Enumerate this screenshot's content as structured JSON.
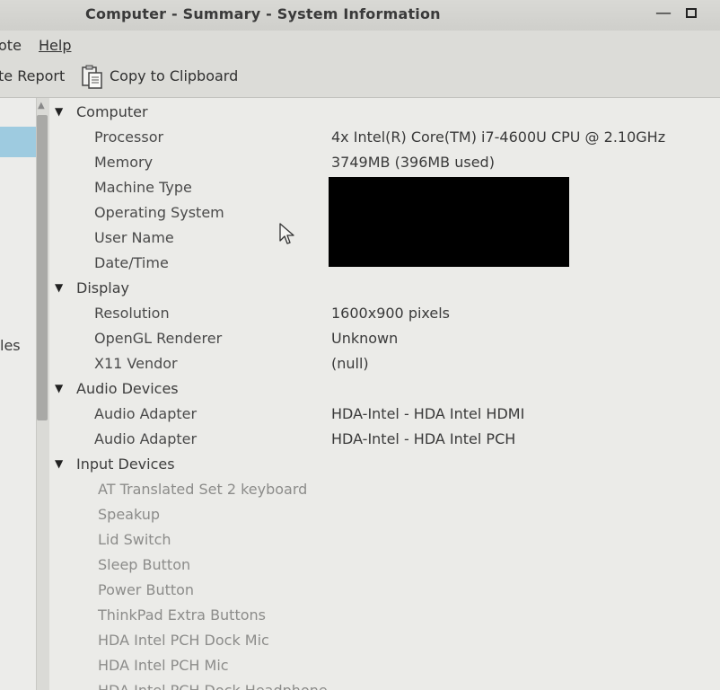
{
  "window": {
    "title": "Computer - Summary - System Information"
  },
  "menubar": {
    "items": [
      {
        "label": "ote"
      },
      {
        "label": "Help"
      }
    ]
  },
  "toolbar": {
    "generate_label": "te Report",
    "copy_label": "Copy to Clipboard",
    "copy_icon": "clipboard-icon"
  },
  "sidebar": {
    "partial_label": "les"
  },
  "tree": {
    "computer": {
      "label": "Computer",
      "rows": [
        {
          "key": "Processor",
          "value": "4x Intel(R) Core(TM) i7-4600U CPU @ 2.10GHz"
        },
        {
          "key": "Memory",
          "value": "3749MB (396MB used)"
        },
        {
          "key": "Machine Type",
          "value": ""
        },
        {
          "key": "Operating System",
          "value": ""
        },
        {
          "key": "User Name",
          "value": ""
        },
        {
          "key": "Date/Time",
          "value": ""
        }
      ]
    },
    "display": {
      "label": "Display",
      "rows": [
        {
          "key": "Resolution",
          "value": "1600x900 pixels"
        },
        {
          "key": "OpenGL Renderer",
          "value": "Unknown"
        },
        {
          "key": "X11 Vendor",
          "value": "(null)"
        }
      ]
    },
    "audio": {
      "label": "Audio Devices",
      "rows": [
        {
          "key": "Audio Adapter",
          "value": "HDA-Intel - HDA Intel HDMI"
        },
        {
          "key": "Audio Adapter",
          "value": "HDA-Intel - HDA Intel PCH"
        }
      ]
    },
    "input": {
      "label": "Input Devices",
      "rows": [
        {
          "key": "AT Translated Set 2 keyboard"
        },
        {
          "key": "Speakup"
        },
        {
          "key": "Lid Switch"
        },
        {
          "key": "Sleep Button"
        },
        {
          "key": "Power Button"
        },
        {
          "key": "ThinkPad Extra Buttons"
        },
        {
          "key": "HDA Intel PCH Dock Mic"
        },
        {
          "key": "HDA Intel PCH Mic"
        },
        {
          "key": "HDA Intel PCH Dock Headphone"
        }
      ]
    }
  },
  "colors": {
    "selection": "#9ecbe0",
    "redaction": "#000000"
  }
}
